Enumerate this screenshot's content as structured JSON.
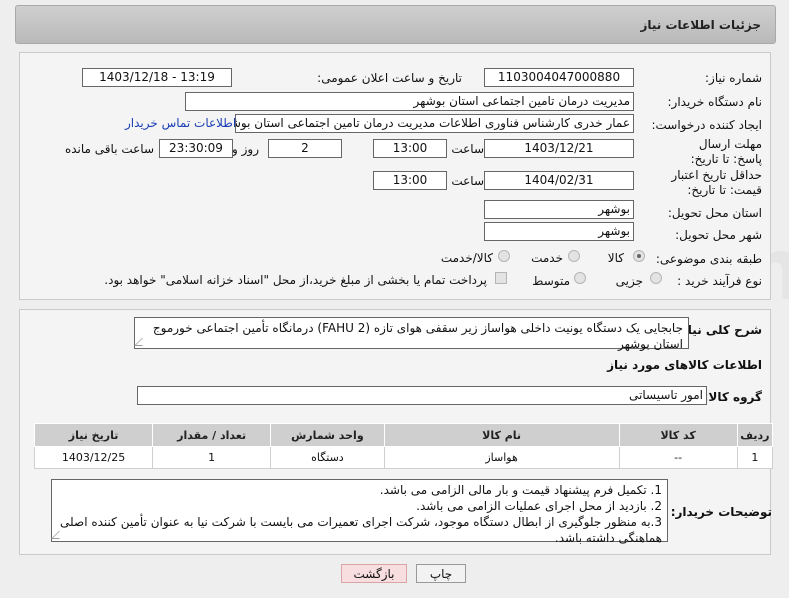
{
  "header": {
    "title": "جزئیات اطلاعات نیاز"
  },
  "watermark": "AriaTender.neT",
  "labels": {
    "need_number": "شماره نیاز:",
    "announce_datetime": "تاریخ و ساعت اعلان عمومی:",
    "buyer_org": "نام دستگاه خریدار:",
    "requester": "ایجاد کننده درخواست:",
    "reply_deadline": "مهلت ارسال پاسخ: تا تاریخ:",
    "price_validity": "حداقل تاریخ اعتبار قیمت: تا تاریخ:",
    "time": "ساعت",
    "day_and": "روز و",
    "remaining": "ساعت باقی مانده",
    "delivery_province": "استان محل تحویل:",
    "delivery_city": "شهر محل تحویل:",
    "category": "طبقه بندی موضوعی:",
    "process_type": "نوع فرآیند خرید :",
    "general_desc": "شرح کلی نیاز:",
    "goods_info": "اطلاعات کالاهای مورد نیاز",
    "goods_group": "گروه کالا:",
    "buyer_notes": "توضیحات خریدار:"
  },
  "values": {
    "need_number": "1103004047000880",
    "announce_datetime": "1403/12/18 - 13:19",
    "buyer_org": "مدیریت درمان تامین اجتماعی استان بوشهر",
    "requester": "عمار خدری کارشناس فناوری اطلاعات مدیریت درمان تامین اجتماعی استان بوشهر",
    "contact_link": "اطلاعات تماس خریدار",
    "reply_date": "1403/12/21",
    "reply_time": "13:00",
    "reply_days": "2",
    "reply_remaining": "23:30:09",
    "validity_date": "1404/02/31",
    "validity_time": "13:00",
    "delivery_province": "بوشهر",
    "delivery_city": "بوشهر",
    "general_desc": "جابجایی یک دستگاه یونیت داخلی هواساز زیر سقفی هوای تازه (FAHU 2) درمانگاه تأمین اجتماعی خورموج استان بوشهر",
    "goods_group": "امور تاسیساتی"
  },
  "category_options": [
    {
      "label": "کالا",
      "selected": true
    },
    {
      "label": "خدمت",
      "selected": false
    },
    {
      "label": "کالا/خدمت",
      "selected": false
    }
  ],
  "process_options": [
    {
      "label": "جزیی",
      "selected": false
    },
    {
      "label": "متوسط",
      "selected": false
    }
  ],
  "payment_note": "پرداخت تمام یا بخشی از مبلغ خرید،از محل \"اسناد خزانه اسلامی\" خواهد بود.",
  "table": {
    "headers": [
      "ردیف",
      "کد کالا",
      "نام کالا",
      "واحد شمارش",
      "تعداد / مقدار",
      "تاریخ نیاز"
    ],
    "rows": [
      [
        "1",
        "--",
        "هواساز",
        "دستگاه",
        "1",
        "1403/12/25"
      ]
    ]
  },
  "buyer_notes": [
    "1. تکمیل فرم پیشنهاد قیمت و بار مالی الزامی می باشد.",
    "2. بازدید از محل اجرای عملیات الزامی می باشد.",
    "3.به منظور جلوگیری از ابطال دستگاه موجود، شرکت اجرای تعمیرات می بایست با شرکت نیا به عنوان تأمین کننده اصلی هماهنگی داشته باشد."
  ],
  "buttons": {
    "print": "چاپ",
    "back": "بازگشت"
  },
  "colors": {
    "link": "#1a3fb5",
    "header_bg": "#c4c4c4",
    "back_button_bg": "#f8dede"
  }
}
